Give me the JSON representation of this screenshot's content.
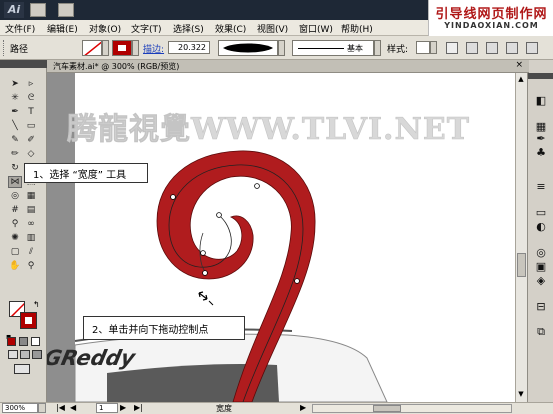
{
  "app": {
    "logo_text": "Ai",
    "brand_name": "引导线网页制作网",
    "brand_url": "YINDAOXIAN.COM"
  },
  "menu": [
    "文件(F)",
    "编辑(E)",
    "对象(O)",
    "文字(T)",
    "选择(S)",
    "效果(C)",
    "视图(V)",
    "窗口(W)",
    "帮助(H)"
  ],
  "controlbar": {
    "selection_type": "路径",
    "stroke_label": "描边:",
    "stroke_weight": "20.322",
    "profile_label": "基本",
    "style_label": "样式:",
    "fill_color": "#ffffff",
    "stroke_color": "#b00000"
  },
  "document": {
    "tab_title": "汽车素材.ai* @ 300% (RGB/预览)"
  },
  "canvas": {
    "watermark": "腾龍視覺WWW.TLVI.NET",
    "logo_text": "GReddy",
    "spiral_color": "#b01c1e"
  },
  "callouts": [
    {
      "label": "1、选择 “宽度” 工具"
    },
    {
      "label": "2、单击并向下拖动控制点"
    }
  ],
  "statusbar": {
    "zoom": "300%",
    "page": "1",
    "tool_name": "宽度"
  }
}
